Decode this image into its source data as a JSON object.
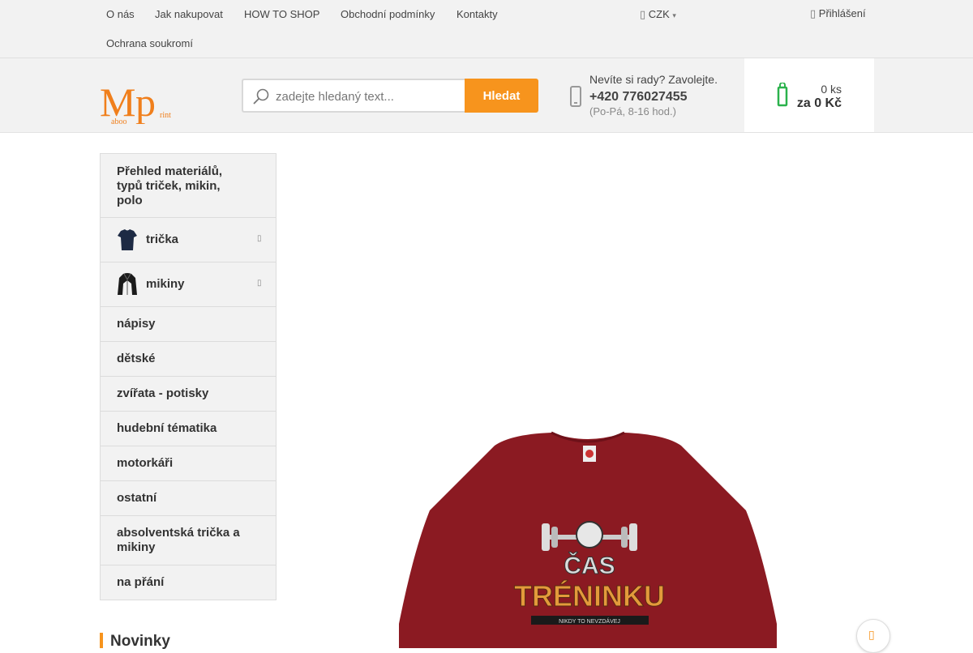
{
  "topnav": {
    "links": [
      "O nás",
      "Jak nakupovat",
      "HOW TO SHOP",
      "Obchodní podmínky",
      "Kontakty",
      "Ochrana soukromí"
    ],
    "currency": "CZK",
    "login": "Přihlášení"
  },
  "search": {
    "placeholder": "zadejte hledaný text...",
    "button": "Hledat"
  },
  "help": {
    "text": "Nevíte si rady? Zavolejte.",
    "phone": "+420 776027455",
    "hours": "(Po-Pá, 8-16 hod.)"
  },
  "cart": {
    "quantity": "0 ks",
    "price": "za 0 Kč"
  },
  "sidebar": {
    "items": [
      {
        "label": "Přehled materiálů, typů triček, mikin, polo"
      },
      {
        "label": "trička"
      },
      {
        "label": "mikiny"
      },
      {
        "label": "nápisy"
      },
      {
        "label": "dětské"
      },
      {
        "label": "zvířata - potisky"
      },
      {
        "label": "hudební tématika"
      },
      {
        "label": "motorkáři"
      },
      {
        "label": "ostatní"
      },
      {
        "label": "absolventská trička a mikiny"
      },
      {
        "label": "na přání"
      }
    ]
  },
  "section": {
    "novinky": "Novinky"
  },
  "product": {
    "print_line1": "ČAS",
    "print_line2": "TRÉNINKU",
    "print_line3": "NIKDY TO NEVZDÁVEJ"
  },
  "colors": {
    "accent": "#f7941d",
    "cart": "#2bb24c",
    "shirt": "#8b1a22"
  }
}
